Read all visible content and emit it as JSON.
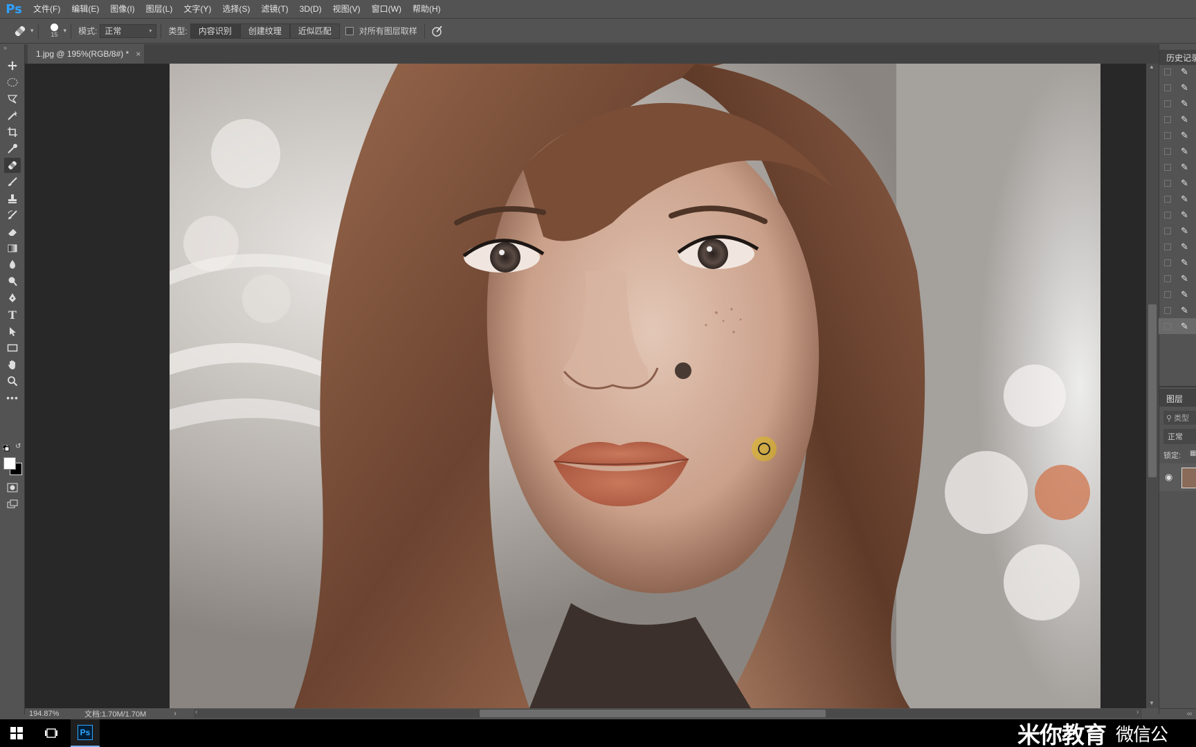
{
  "app": {
    "logo": "Ps"
  },
  "menu": [
    "文件(F)",
    "编辑(E)",
    "图像(I)",
    "图层(L)",
    "文字(Y)",
    "选择(S)",
    "滤镜(T)",
    "3D(D)",
    "视图(V)",
    "窗口(W)",
    "帮助(H)"
  ],
  "options": {
    "brush_size": "15",
    "mode_label": "模式:",
    "mode_value": "正常",
    "type_label": "类型:",
    "type_buttons": [
      "内容识别",
      "创建纹理",
      "近似匹配"
    ],
    "sample_all_label": "对所有图层取样"
  },
  "document": {
    "tab_title": "1.jpg @ 195%(RGB/8#) *",
    "close_glyph": "×"
  },
  "status": {
    "zoom": "194.87%",
    "doc_size": "文档:1.70M/1.70M"
  },
  "panels": {
    "history_title": "历史记录",
    "layers_title": "图层",
    "layers_search": "类型",
    "layers_blend": "正常",
    "lock_label": "锁定:"
  },
  "watermark": {
    "brand": "米你教育",
    "sub": "微信公"
  },
  "colors": {
    "ps_blue": "#2fa1ff",
    "ui_bg": "#535353",
    "pasteboard": "#282828",
    "brush_cursor": "#e4c400"
  }
}
